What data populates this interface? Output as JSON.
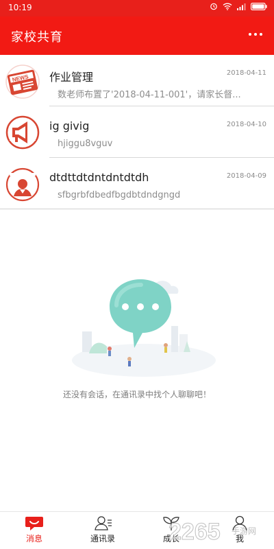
{
  "status_bar": {
    "time": "10:19"
  },
  "header": {
    "title": "家校共育"
  },
  "conversations": [
    {
      "name": "作业管理",
      "date": "2018-04-11",
      "preview": "数老师布置了'2018-04-11-001'，请家长督..."
    },
    {
      "name": "ig givig",
      "date": "2018-04-10",
      "preview": "hjiggu8vguv"
    },
    {
      "name": "dtdttdtdntdntdtdh",
      "date": "2018-04-09",
      "preview": "sfbgrbfdbedfbgdbtdndgngd"
    }
  ],
  "empty_state": {
    "message": "还没有会话，在通讯录中找个人聊聊吧！"
  },
  "bottom_nav": {
    "tabs": [
      {
        "label": "消息",
        "active": true
      },
      {
        "label": "通讯录",
        "active": false
      },
      {
        "label": "成长",
        "active": false
      },
      {
        "label": "我",
        "active": false
      }
    ]
  },
  "watermark": {
    "text": "2265",
    "subtext": "手游网"
  },
  "colors": {
    "brand_red": "#f21a14",
    "text_primary": "#222222",
    "text_secondary": "#8c8c8c"
  }
}
